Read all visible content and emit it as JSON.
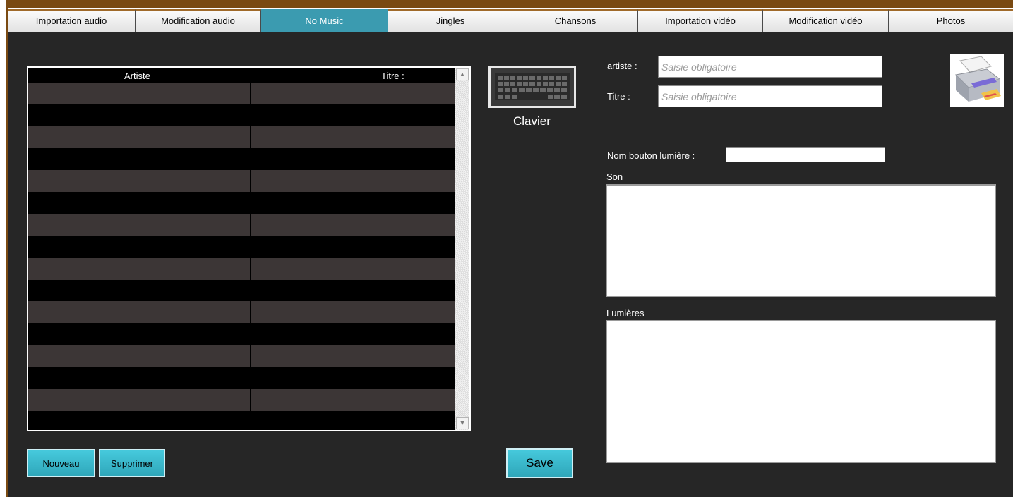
{
  "tabs": [
    {
      "label": "Importation audio",
      "active": false
    },
    {
      "label": "Modification audio",
      "active": false
    },
    {
      "label": "No Music",
      "active": true
    },
    {
      "label": "Jingles",
      "active": false
    },
    {
      "label": "Chansons",
      "active": false
    },
    {
      "label": "Importation vidéo",
      "active": false
    },
    {
      "label": "Modification vidéo",
      "active": false
    },
    {
      "label": "Photos",
      "active": false
    }
  ],
  "grid": {
    "columns": [
      "Artiste",
      "Titre :"
    ],
    "rows": [
      [
        "",
        ""
      ],
      [
        "",
        ""
      ],
      [
        "",
        ""
      ],
      [
        "",
        ""
      ],
      [
        "",
        ""
      ],
      [
        "",
        ""
      ],
      [
        "",
        ""
      ],
      [
        "",
        ""
      ],
      [
        "",
        ""
      ],
      [
        "",
        ""
      ],
      [
        "",
        ""
      ],
      [
        "",
        ""
      ],
      [
        "",
        ""
      ],
      [
        "",
        ""
      ],
      [
        "",
        ""
      ],
      [
        "",
        ""
      ]
    ],
    "scroll_up_icon": "arrow-up-icon",
    "scroll_down_icon": "arrow-down-icon"
  },
  "keyboard": {
    "icon": "keyboard-icon",
    "label": "Clavier"
  },
  "form": {
    "artiste_label": "artiste :",
    "artiste_placeholder": "Saisie obligatoire",
    "artiste_value": "",
    "titre_label": "Titre :",
    "titre_placeholder": "Saisie obligatoire",
    "titre_value": "",
    "light_button_label": "Nom bouton lumière :",
    "light_button_value": "",
    "son_label": "Son",
    "son_value": "",
    "lumieres_label": "Lumières",
    "lumieres_value": ""
  },
  "printer": {
    "icon": "printer-icon"
  },
  "buttons": {
    "nouveau": "Nouveau",
    "supprimer": "Supprimer",
    "save": "Save"
  },
  "colors": {
    "accent": "#3b9bb0",
    "button": "#35b8cc",
    "background": "#262626",
    "row_alt": "#3c3636",
    "frame": "#7a4a12"
  }
}
